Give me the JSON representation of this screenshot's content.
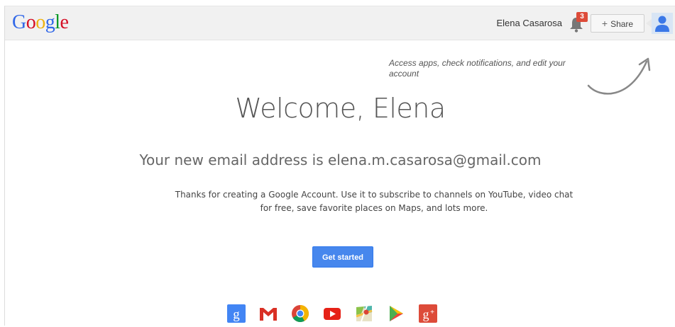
{
  "header": {
    "logo_letters": [
      "G",
      "o",
      "o",
      "g",
      "l",
      "e"
    ],
    "logo_colors": [
      "#3369e8",
      "#d50f25",
      "#eeb211",
      "#3369e8",
      "#009925",
      "#d50f25"
    ],
    "user_name": "Elena Casarosa",
    "notification_count": "3",
    "share_plus": "+",
    "share_label": "Share"
  },
  "hint": {
    "text": "Access apps, check notifications, and edit your account"
  },
  "main": {
    "welcome": "Welcome, Elena",
    "email_line": "Your new email address is elena.m.casarosa@gmail.com",
    "thanks": "Thanks for creating a Google Account. Use it to subscribe to channels on YouTube, video chat for free, save favorite places on Maps, and lots more.",
    "cta_label": "Get started"
  },
  "apps": [
    {
      "name": "google-search-icon"
    },
    {
      "name": "gmail-icon"
    },
    {
      "name": "chrome-icon"
    },
    {
      "name": "youtube-icon"
    },
    {
      "name": "maps-icon"
    },
    {
      "name": "play-icon"
    },
    {
      "name": "google-plus-icon"
    }
  ],
  "colors": {
    "accent": "#4787ed",
    "badge": "#dd4b39",
    "topbar": "#f1f1f1"
  }
}
